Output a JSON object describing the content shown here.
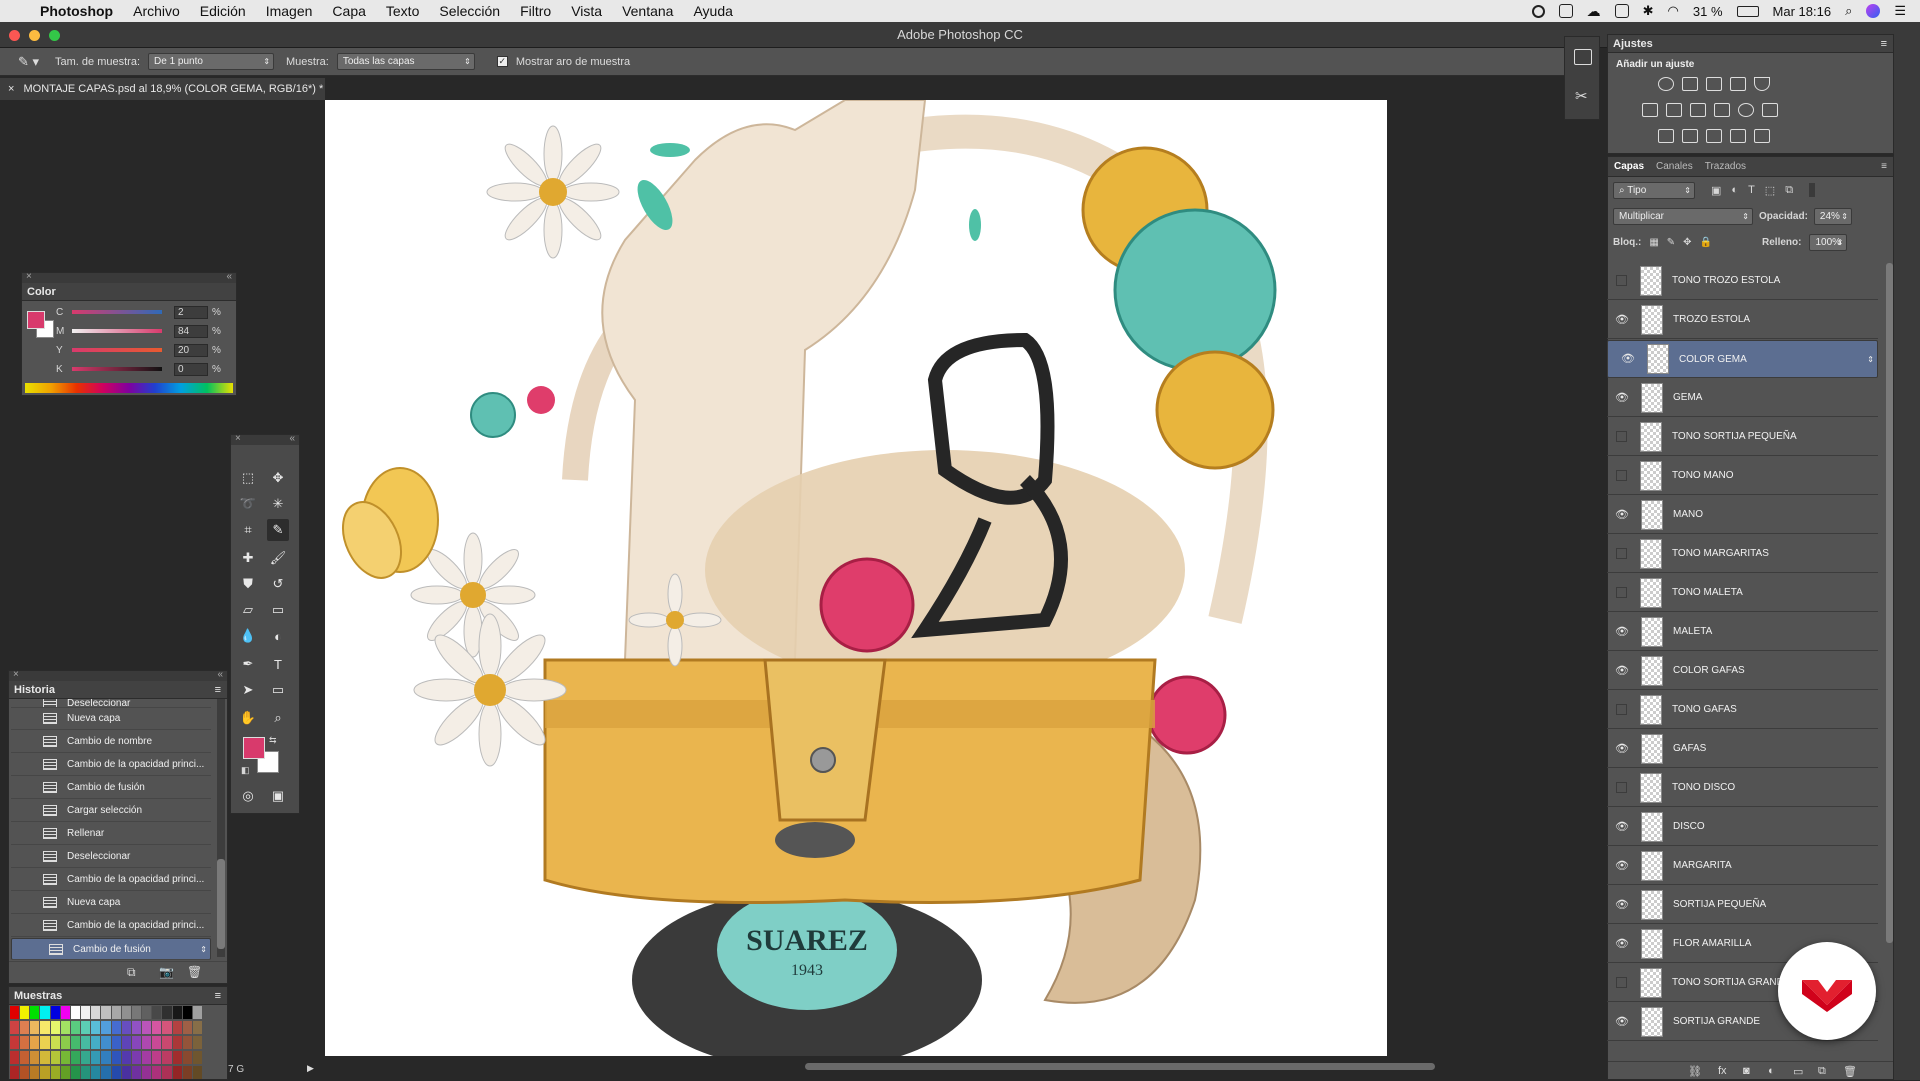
{
  "menubar": {
    "app": "Photoshop",
    "items": [
      "Archivo",
      "Edición",
      "Imagen",
      "Capa",
      "Texto",
      "Selección",
      "Filtro",
      "Vista",
      "Ventana",
      "Ayuda"
    ],
    "battery": "31 %",
    "datetime": "Mar 18:16"
  },
  "window": {
    "title": "Adobe Photoshop CC"
  },
  "options": {
    "sample_size_label": "Tam. de muestra:",
    "sample_size_value": "De 1 punto",
    "sample_label": "Muestra:",
    "sample_value": "Todas las capas",
    "show_ring_label": "Mostrar aro de muestra"
  },
  "document": {
    "tab": "MONTAJE CAPAS.psd al 18,9% (COLOR GEMA, RGB/16*) *",
    "zoom": "7 G",
    "canvas_text": {
      "brand": "SUAREZ",
      "year": "1943"
    }
  },
  "color_panel": {
    "title": "Color",
    "channels": [
      {
        "label": "C",
        "value": "2"
      },
      {
        "label": "M",
        "value": "84"
      },
      {
        "label": "Y",
        "value": "20"
      },
      {
        "label": "K",
        "value": "0"
      }
    ],
    "percent": "%",
    "foreground": "#d83a6c",
    "background": "#ffffff"
  },
  "history_panel": {
    "title": "Historia",
    "items": [
      "Deseleccionar",
      "Nueva capa",
      "Cambio de nombre",
      "Cambio de la opacidad princi...",
      "Cambio de fusión",
      "Cargar selección",
      "Rellenar",
      "Deseleccionar",
      "Cambio de la opacidad princi...",
      "Nueva capa",
      "Cambio de la opacidad princi...",
      "Cambio de fusión"
    ]
  },
  "swatches_panel": {
    "title": "Muestras"
  },
  "adjustments_panel": {
    "title": "Ajustes",
    "subtitle": "Añadir un ajuste"
  },
  "layers_panel": {
    "tabs": [
      "Capas",
      "Canales",
      "Trazados"
    ],
    "filter": "Tipo",
    "blend_mode": "Multiplicar",
    "opacity_label": "Opacidad:",
    "opacity": "24%",
    "lock_label": "Bloq.:",
    "fill_label": "Relleno:",
    "fill": "100%",
    "layers": [
      {
        "name": "TONO TROZO ESTOLA",
        "visible": false
      },
      {
        "name": "TROZO ESTOLA",
        "visible": true
      },
      {
        "name": "COLOR GEMA",
        "visible": true,
        "selected": true
      },
      {
        "name": "GEMA",
        "visible": true
      },
      {
        "name": "TONO SORTIJA PEQUEÑA",
        "visible": false
      },
      {
        "name": "TONO MANO",
        "visible": false
      },
      {
        "name": "MANO",
        "visible": true
      },
      {
        "name": "TONO MARGARITAS",
        "visible": false
      },
      {
        "name": "TONO MALETA",
        "visible": false
      },
      {
        "name": "MALETA",
        "visible": true
      },
      {
        "name": "COLOR GAFAS",
        "visible": true
      },
      {
        "name": "TONO GAFAS",
        "visible": false
      },
      {
        "name": "GAFAS",
        "visible": true
      },
      {
        "name": "TONO DISCO",
        "visible": false
      },
      {
        "name": "DISCO",
        "visible": true
      },
      {
        "name": "MARGARITA",
        "visible": true
      },
      {
        "name": "SORTIJA PEQUEÑA",
        "visible": true
      },
      {
        "name": "FLOR AMARILLA",
        "visible": true
      },
      {
        "name": "TONO SORTIJA GRANDE",
        "visible": false
      },
      {
        "name": "SORTIJA GRANDE",
        "visible": true
      }
    ]
  },
  "colors": {
    "accent": "#5c6e91",
    "brand": "#d0021b"
  }
}
